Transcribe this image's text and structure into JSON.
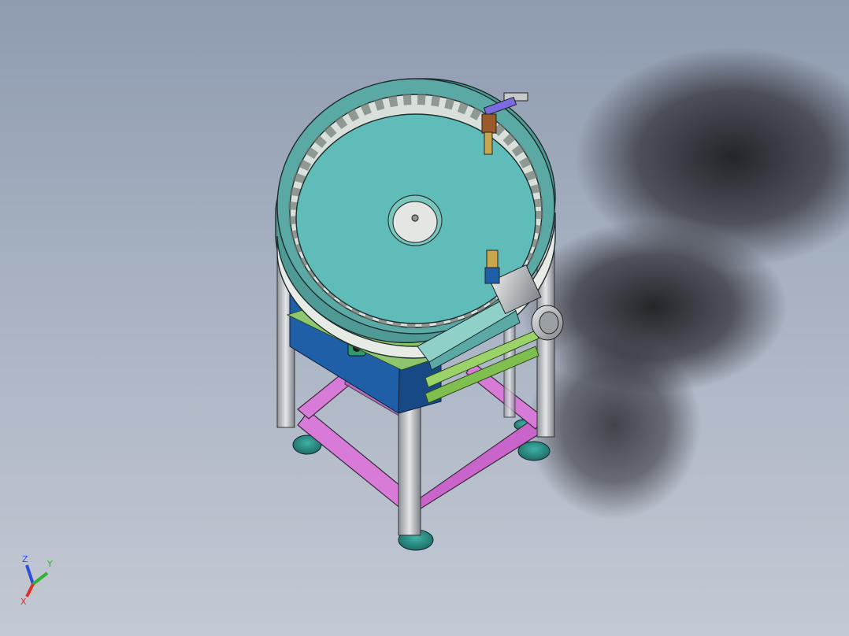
{
  "viewport": {
    "background_top": "#8f9bb0",
    "background_bottom": "#c3c9d4"
  },
  "model": {
    "bowl_rim_color": "#5aa9a4",
    "bowl_floor_color": "#5fbcb8",
    "base_panel_color": "#1f5fa8",
    "frame_color": "#c8ccd0",
    "brace_color": "#d77ad8",
    "plate_color": "#9bd36a",
    "feet_color": "#2b8d84",
    "motor_color": "#b9bec3"
  },
  "triad": {
    "x_label": "X",
    "y_label": "Y",
    "z_label": "Z",
    "x_color": "#e0302a",
    "y_color": "#2fb335",
    "z_color": "#2a4ee0"
  }
}
